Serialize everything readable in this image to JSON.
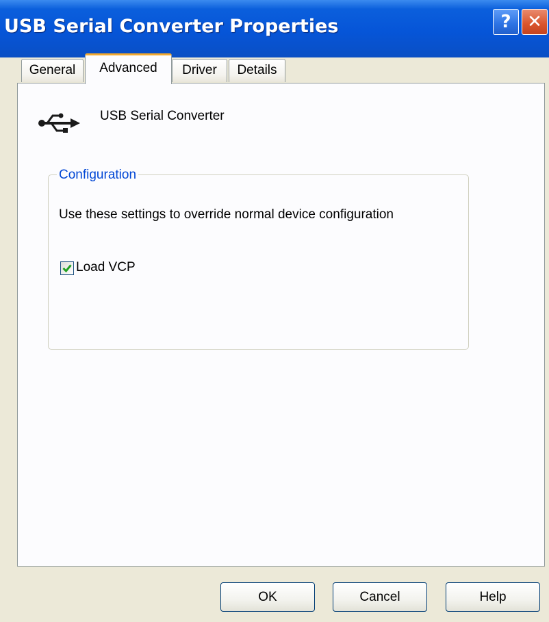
{
  "window": {
    "title": "USB Serial Converter Properties"
  },
  "titlebar_buttons": {
    "help_label": "?",
    "close_label": "✕"
  },
  "tabs": [
    {
      "label": "General",
      "active": false
    },
    {
      "label": "Advanced",
      "active": true
    },
    {
      "label": "Driver",
      "active": false
    },
    {
      "label": "Details",
      "active": false
    }
  ],
  "device": {
    "icon": "usb-icon",
    "name": "USB Serial Converter"
  },
  "configuration": {
    "title": "Configuration",
    "description": "Use these settings to override normal device configuration",
    "load_vcp": {
      "label": "Load VCP",
      "checked": true
    }
  },
  "buttons": {
    "ok": "OK",
    "cancel": "Cancel",
    "help": "Help"
  },
  "colors": {
    "titlebar": "#0655d8",
    "group_title": "#0046d5",
    "active_tab_accent": "#f2a930",
    "dialog_background": "#ece9d8"
  }
}
